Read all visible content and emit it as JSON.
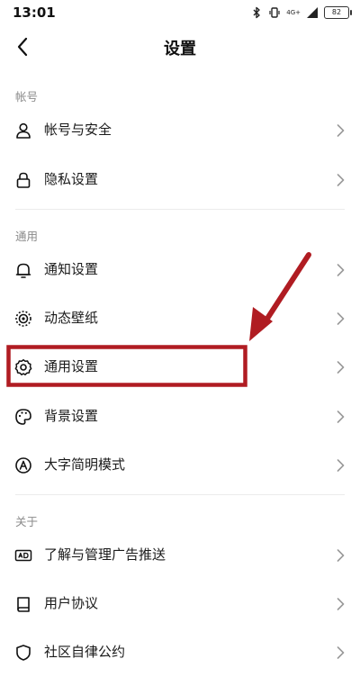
{
  "status_bar": {
    "time": "13:01",
    "network": "4G+",
    "battery": "82"
  },
  "header": {
    "title": "设置",
    "back_icon": "chevron-left-icon"
  },
  "sections": [
    {
      "title": "帐号",
      "items": [
        {
          "label": "帐号与安全",
          "icon": "user-icon"
        },
        {
          "label": "隐私设置",
          "icon": "lock-icon"
        }
      ]
    },
    {
      "title": "通用",
      "items": [
        {
          "label": "通知设置",
          "icon": "bell-icon"
        },
        {
          "label": "动态壁纸",
          "icon": "dynamic-wallpaper-icon"
        },
        {
          "label": "通用设置",
          "icon": "gear-icon"
        },
        {
          "label": "背景设置",
          "icon": "palette-icon"
        },
        {
          "label": "大字简明模式",
          "icon": "large-text-icon"
        }
      ]
    },
    {
      "title": "关于",
      "items": [
        {
          "label": "了解与管理广告推送",
          "icon": "ad-icon"
        },
        {
          "label": "用户协议",
          "icon": "book-icon"
        },
        {
          "label": "社区自律公约",
          "icon": "shield-icon"
        }
      ]
    }
  ],
  "highlight": {
    "target": "通用设置",
    "color": "#b01c22"
  }
}
